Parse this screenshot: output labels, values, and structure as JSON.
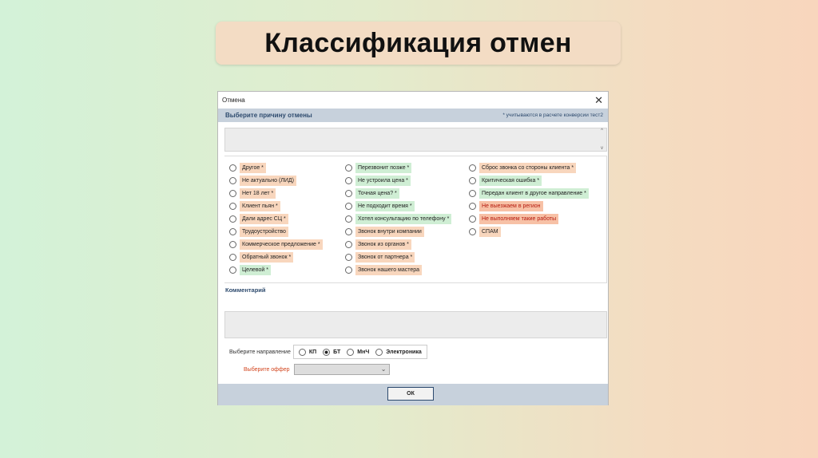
{
  "slide_title": "Классификация отмен",
  "dialog": {
    "title": "Отмена",
    "close_glyph": "✕",
    "header": "Выберите причину отмены",
    "note": "* учитываются в расчете конверсии тест2",
    "scroll_up": "^",
    "scroll_down": "v",
    "reasons_col1": [
      {
        "label": "Другое *",
        "color": "orange"
      },
      {
        "label": "Не актуально (ЛИД)",
        "color": "orange"
      },
      {
        "label": "Нет 18 лет *",
        "color": "orange"
      },
      {
        "label": "Клиент пьян *",
        "color": "orange"
      },
      {
        "label": "Дали адрес СЦ *",
        "color": "orange"
      },
      {
        "label": "Трудоустройство",
        "color": "orange"
      },
      {
        "label": "Коммерческое предложение *",
        "color": "orange"
      },
      {
        "label": "Обратный звонок *",
        "color": "orange"
      },
      {
        "label": "Целевой *",
        "color": "green"
      }
    ],
    "reasons_col2": [
      {
        "label": "Перезвонит позже *",
        "color": "green"
      },
      {
        "label": "Не устроила цена *",
        "color": "green"
      },
      {
        "label": "Точная цена? *",
        "color": "green"
      },
      {
        "label": "Не подходит время *",
        "color": "green"
      },
      {
        "label": "Хотел консультацию по телефону *",
        "color": "green"
      },
      {
        "label": "Звонок внутри компании",
        "color": "orange"
      },
      {
        "label": "Звонок из органов *",
        "color": "orange"
      },
      {
        "label": "Звонок от партнера *",
        "color": "orange"
      },
      {
        "label": "Звонок нашего мастера",
        "color": "orange"
      }
    ],
    "reasons_col3": [
      {
        "label": "Сброс звонка со стороны клиента *",
        "color": "orange"
      },
      {
        "label": "Критическая ошибка *",
        "color": "green"
      },
      {
        "label": "Передан клиент в другое направление *",
        "color": "green"
      },
      {
        "label": "Не выезжаем в регион",
        "color": "red"
      },
      {
        "label": "Не выполняем такие работы",
        "color": "red"
      },
      {
        "label": "СПАМ",
        "color": "orange"
      }
    ],
    "comment_label": "Комментарий",
    "direction_label": "Выберите направление",
    "directions": [
      {
        "label": "КП",
        "selected": false
      },
      {
        "label": "БТ",
        "selected": true
      },
      {
        "label": "МнЧ",
        "selected": false
      },
      {
        "label": "Электроника",
        "selected": false
      }
    ],
    "offer_label": "Выберите оффер",
    "offer_value": "",
    "ok_label": "ОК"
  },
  "colors": {
    "orange": "#f8d6bd",
    "green": "#cfeed4",
    "red": "#f7c1a6",
    "header_band": "#c7d1dc",
    "header_text": "#2e4b6e"
  }
}
